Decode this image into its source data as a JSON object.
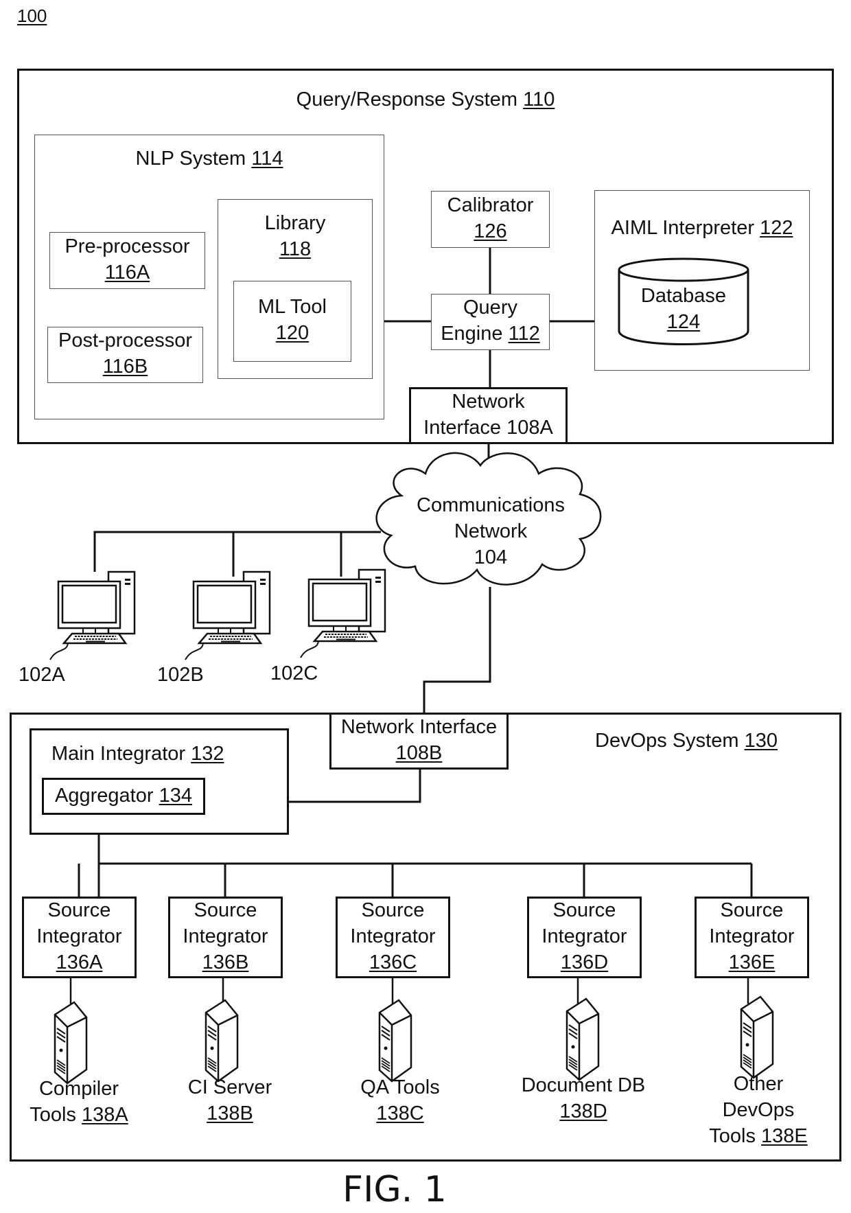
{
  "figure": {
    "ref": "100",
    "caption": "FIG. 1"
  },
  "query_response_system": {
    "title": "Query/Response System",
    "ref": "110",
    "nlp_system": {
      "title": "NLP System",
      "ref": "114",
      "pre_processor": {
        "title": "Pre-processor",
        "ref": "116A"
      },
      "post_processor": {
        "title": "Post-processor",
        "ref": "116B"
      },
      "library": {
        "title": "Library",
        "ref": "118",
        "ml_tool": {
          "title": "ML Tool",
          "ref": "120"
        }
      }
    },
    "calibrator": {
      "title": "Calibrator",
      "ref": "126"
    },
    "query_engine": {
      "line1": "Query",
      "line2": "Engine",
      "ref": "112"
    },
    "aiml_interpreter": {
      "title": "AIML Interpreter",
      "ref": "122",
      "database": {
        "title": "Database",
        "ref": "124"
      }
    },
    "network_interface": {
      "line1": "Network",
      "line2": "Interface 108A"
    }
  },
  "communications_network": {
    "line1": "Communications",
    "line2": "Network",
    "line3": "104"
  },
  "clients": [
    {
      "ref": "102A"
    },
    {
      "ref": "102B"
    },
    {
      "ref": "102C"
    }
  ],
  "devops_system": {
    "title": "DevOps System",
    "ref": "130",
    "network_interface": {
      "title": "Network Interface",
      "ref": "108B"
    },
    "main_integrator": {
      "title": "Main Integrator",
      "ref": "132",
      "aggregator": {
        "title": "Aggregator",
        "ref": "134"
      }
    },
    "source_integrators": [
      {
        "line1": "Source",
        "line2": "Integrator",
        "ref": "136A"
      },
      {
        "line1": "Source",
        "line2": "Integrator",
        "ref": "136B"
      },
      {
        "line1": "Source",
        "line2": "Integrator",
        "ref": "136C"
      },
      {
        "line1": "Source",
        "line2": "Integrator",
        "ref": "136D"
      },
      {
        "line1": "Source",
        "line2": "Integrator",
        "ref": "136E"
      }
    ],
    "tools": [
      {
        "line1": "Compiler",
        "line2": "Tools",
        "ref": "138A"
      },
      {
        "line1": "CI Server",
        "line2": "",
        "ref": "138B"
      },
      {
        "line1": "QA Tools",
        "line2": "",
        "ref": "138C"
      },
      {
        "line1": "Document DB",
        "line2": "",
        "ref": "138D"
      },
      {
        "line1": "Other",
        "line2": "DevOps",
        "line3": "Tools",
        "ref": "138E"
      }
    ]
  }
}
